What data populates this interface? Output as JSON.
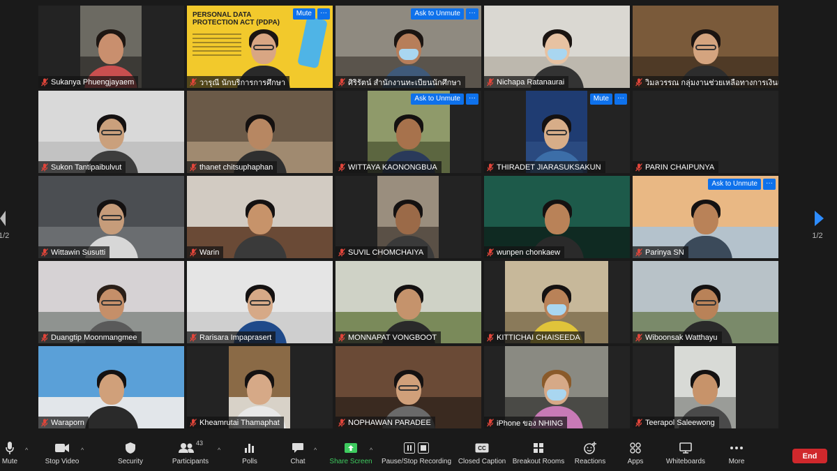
{
  "grid": {
    "tiles": [
      {
        "name": "Sukanya Phuengjayaem",
        "vx": 60,
        "vw": 88,
        "wall": "#6c6a62",
        "floor": "#3c3a36",
        "skin": "#c98f6e",
        "hair": "#1e1612",
        "shirt": "#c94f4f"
      },
      {
        "name": "วารุณี นักบริการการศึกษา",
        "slide": true,
        "slide_title": "PERSONAL DATA PROTECTION ACT (PDPA)",
        "mute_label": "Mute",
        "more": "···",
        "skin": "#d9a683",
        "hair": "#1b1512",
        "shirt": "#2a2a2a"
      },
      {
        "name": "ศิริรัตน์ สำนักงานทะเบียนนักศึกษา",
        "vx": 0,
        "vw": 209,
        "wall": "#8f8a80",
        "floor": "#5a544c",
        "skin": "#b77e5a",
        "hair": "#1a1411",
        "shirt": "#3f5a7a",
        "mask": true,
        "ask_label": "Ask to Unmute",
        "more": "···"
      },
      {
        "name": "Nichapa Ratanaurai",
        "vx": 0,
        "vw": 209,
        "wall": "#dad8d2",
        "floor": "#bdb8ae",
        "skin": "#e7c2a2",
        "hair": "#1a1411",
        "shirt": "#333333",
        "mask": true
      },
      {
        "name": "วิมลวรรณ กลุ่มงานช่วยเหลือทางการเงินแก่นศ.",
        "vx": 0,
        "vw": 209,
        "wall": "#7a5a3a",
        "floor": "#4f3a26",
        "skin": "#d4a47f",
        "hair": "#1b1411",
        "shirt": "#2d2d2d",
        "glasses": true
      },
      {
        "name": "Sukon Tantipaibulvut",
        "vx": 0,
        "vw": 209,
        "wall": "#d9d9d9",
        "floor": "#c2c2c2",
        "skin": "#caa07c",
        "hair": "#141111",
        "shirt": "#3d3d3d",
        "glasses": true
      },
      {
        "name": "thanet chitsuphaphan",
        "vx": 0,
        "vw": 209,
        "wall": "#6b5a48",
        "floor": "#a08a70",
        "skin": "#b78762",
        "hair": "#151110",
        "shirt": "#2f2f2f"
      },
      {
        "name": "WITTAYA KAONONGBUA",
        "vx": 46,
        "vw": 118,
        "wall": "#8f9a6a",
        "floor": "#5c6640",
        "skin": "#a7724c",
        "hair": "#141110",
        "shirt": "#2a3a5a",
        "ask_label": "Ask to Unmute",
        "more": "···"
      },
      {
        "name": "THIRADET JIARASUKSAKUN",
        "vx": 60,
        "vw": 88,
        "wall": "#1f3c72",
        "floor": "#2a4a80",
        "skin": "#d7ad88",
        "hair": "#141111",
        "shirt": "#3c6ea8",
        "glasses": true,
        "mute_label": "Mute",
        "more": "···"
      },
      {
        "name": "PARIN CHAIPUNYA",
        "empty": true
      },
      {
        "name": "Wittawin Susutti",
        "vx": 0,
        "vw": 209,
        "wall": "#4b4e52",
        "floor": "#6a6d70",
        "skin": "#c69c7a",
        "hair": "#141111",
        "shirt": "#d7d7d7",
        "glasses": true
      },
      {
        "name": "Warin",
        "vx": 0,
        "vw": 209,
        "wall": "#d2cbc2",
        "floor": "#6a4a36",
        "skin": "#c7936a",
        "hair": "#141111",
        "shirt": "#3a3a3a"
      },
      {
        "name": "SUVIL CHOMCHAIYA",
        "vx": 60,
        "vw": 88,
        "wall": "#9a8e7e",
        "floor": "#5a5046",
        "skin": "#9b6a48",
        "hair": "#141111",
        "shirt": "#3a3a3a"
      },
      {
        "name": "wunpen chonkaew",
        "vx": 0,
        "vw": 209,
        "wall": "#1d5a4a",
        "floor": "#0f2a22",
        "skin": "#b98258",
        "hair": "#141111",
        "shirt": "#2a2a2a"
      },
      {
        "name": "Parinya SN",
        "vx": 0,
        "vw": 209,
        "wall": "#e9b884",
        "floor": "#b4c2cc",
        "skin": "#b98258",
        "hair": "#141111",
        "shirt": "#3b4a5a",
        "ask_label": "Ask to Unmute",
        "more": "···"
      },
      {
        "name": "Duangtip Moonmangmee",
        "vx": 0,
        "vw": 209,
        "wall": "#d6d2d4",
        "floor": "#8f9390",
        "skin": "#c58f69",
        "hair": "#2a1f18",
        "shirt": "#5a5a5a",
        "glasses": true
      },
      {
        "name": "Rarisara Impaprasert",
        "vx": 0,
        "vw": 209,
        "wall": "#e5e5e5",
        "floor": "#cfcfcf",
        "skin": "#d6a987",
        "hair": "#141111",
        "shirt": "#1f4a8a",
        "glasses": true
      },
      {
        "name": "MONNAPAT VONGBOOT",
        "vx": 0,
        "vw": 209,
        "wall": "#cfd2c6",
        "floor": "#7a8a5a",
        "skin": "#c5936c",
        "hair": "#141111",
        "shirt": "#2a2a2a"
      },
      {
        "name": "KITTICHAI CHAISEEDA",
        "vx": 30,
        "vw": 148,
        "wall": "#c7b89a",
        "floor": "#8a7a5a",
        "skin": "#b98258",
        "hair": "#141111",
        "shirt": "#e0c43a",
        "mask": true
      },
      {
        "name": "Wiboonsak Watthayu",
        "vx": 0,
        "vw": 209,
        "wall": "#b8c2c8",
        "floor": "#7a8a6a",
        "skin": "#b98258",
        "hair": "#141111",
        "shirt": "#2a2a2a",
        "glasses": true
      },
      {
        "name": "Waraporn",
        "vx": 0,
        "vw": 209,
        "wall": "#5aa0d8",
        "floor": "#e2e6ea",
        "skin": "#d0a07a",
        "hair": "#141111",
        "shirt": "#2a2a2a"
      },
      {
        "name": "Kheamrutai Thamaphat",
        "vx": 60,
        "vw": 88,
        "wall": "#8a6a46",
        "floor": "#d8d2c8",
        "skin": "#d6a987",
        "hair": "#141111",
        "shirt": "#e8e8e8"
      },
      {
        "name": "NOPHAWAN PARADEE",
        "vx": 0,
        "vw": 209,
        "wall": "#6a4a36",
        "floor": "#3a2a20",
        "skin": "#d0a07a",
        "hair": "#141111",
        "shirt": "#6a6a6a",
        "glasses": true
      },
      {
        "name": "iPhone ของ NHING",
        "vx": 30,
        "vw": 148,
        "wall": "#8a8a82",
        "floor": "#4a4a46",
        "skin": "#d6a987",
        "hair": "#8a5a2a",
        "shirt": "#c87ab6",
        "mask": true
      },
      {
        "name": "Teerapol Saleewong",
        "vx": 60,
        "vw": 88,
        "wall": "#d8dad6",
        "floor": "#9a9c98",
        "skin": "#c7936a",
        "hair": "#141111",
        "shirt": "#4a4a4a"
      }
    ]
  },
  "paging": {
    "left_label": "1/2",
    "right_label": "1/2"
  },
  "toolbar": {
    "mute": "Mute",
    "stop_video": "Stop Video",
    "security": "Security",
    "participants": "Participants",
    "participants_count": "43",
    "polls": "Polls",
    "chat": "Chat",
    "share_screen": "Share Screen",
    "pause_stop_recording": "Pause/Stop Recording",
    "closed_caption": "Closed Caption",
    "breakout_rooms": "Breakout Rooms",
    "reactions": "Reactions",
    "apps": "Apps",
    "whiteboards": "Whiteboards",
    "more": "More",
    "end": "End",
    "caret": "^"
  },
  "colors": {
    "active_speaker": "#e6e33c",
    "accent_blue": "#0e71eb",
    "share_green": "#3ecb5f",
    "end_red": "#d0282c",
    "muted_red": "#e0453a"
  }
}
